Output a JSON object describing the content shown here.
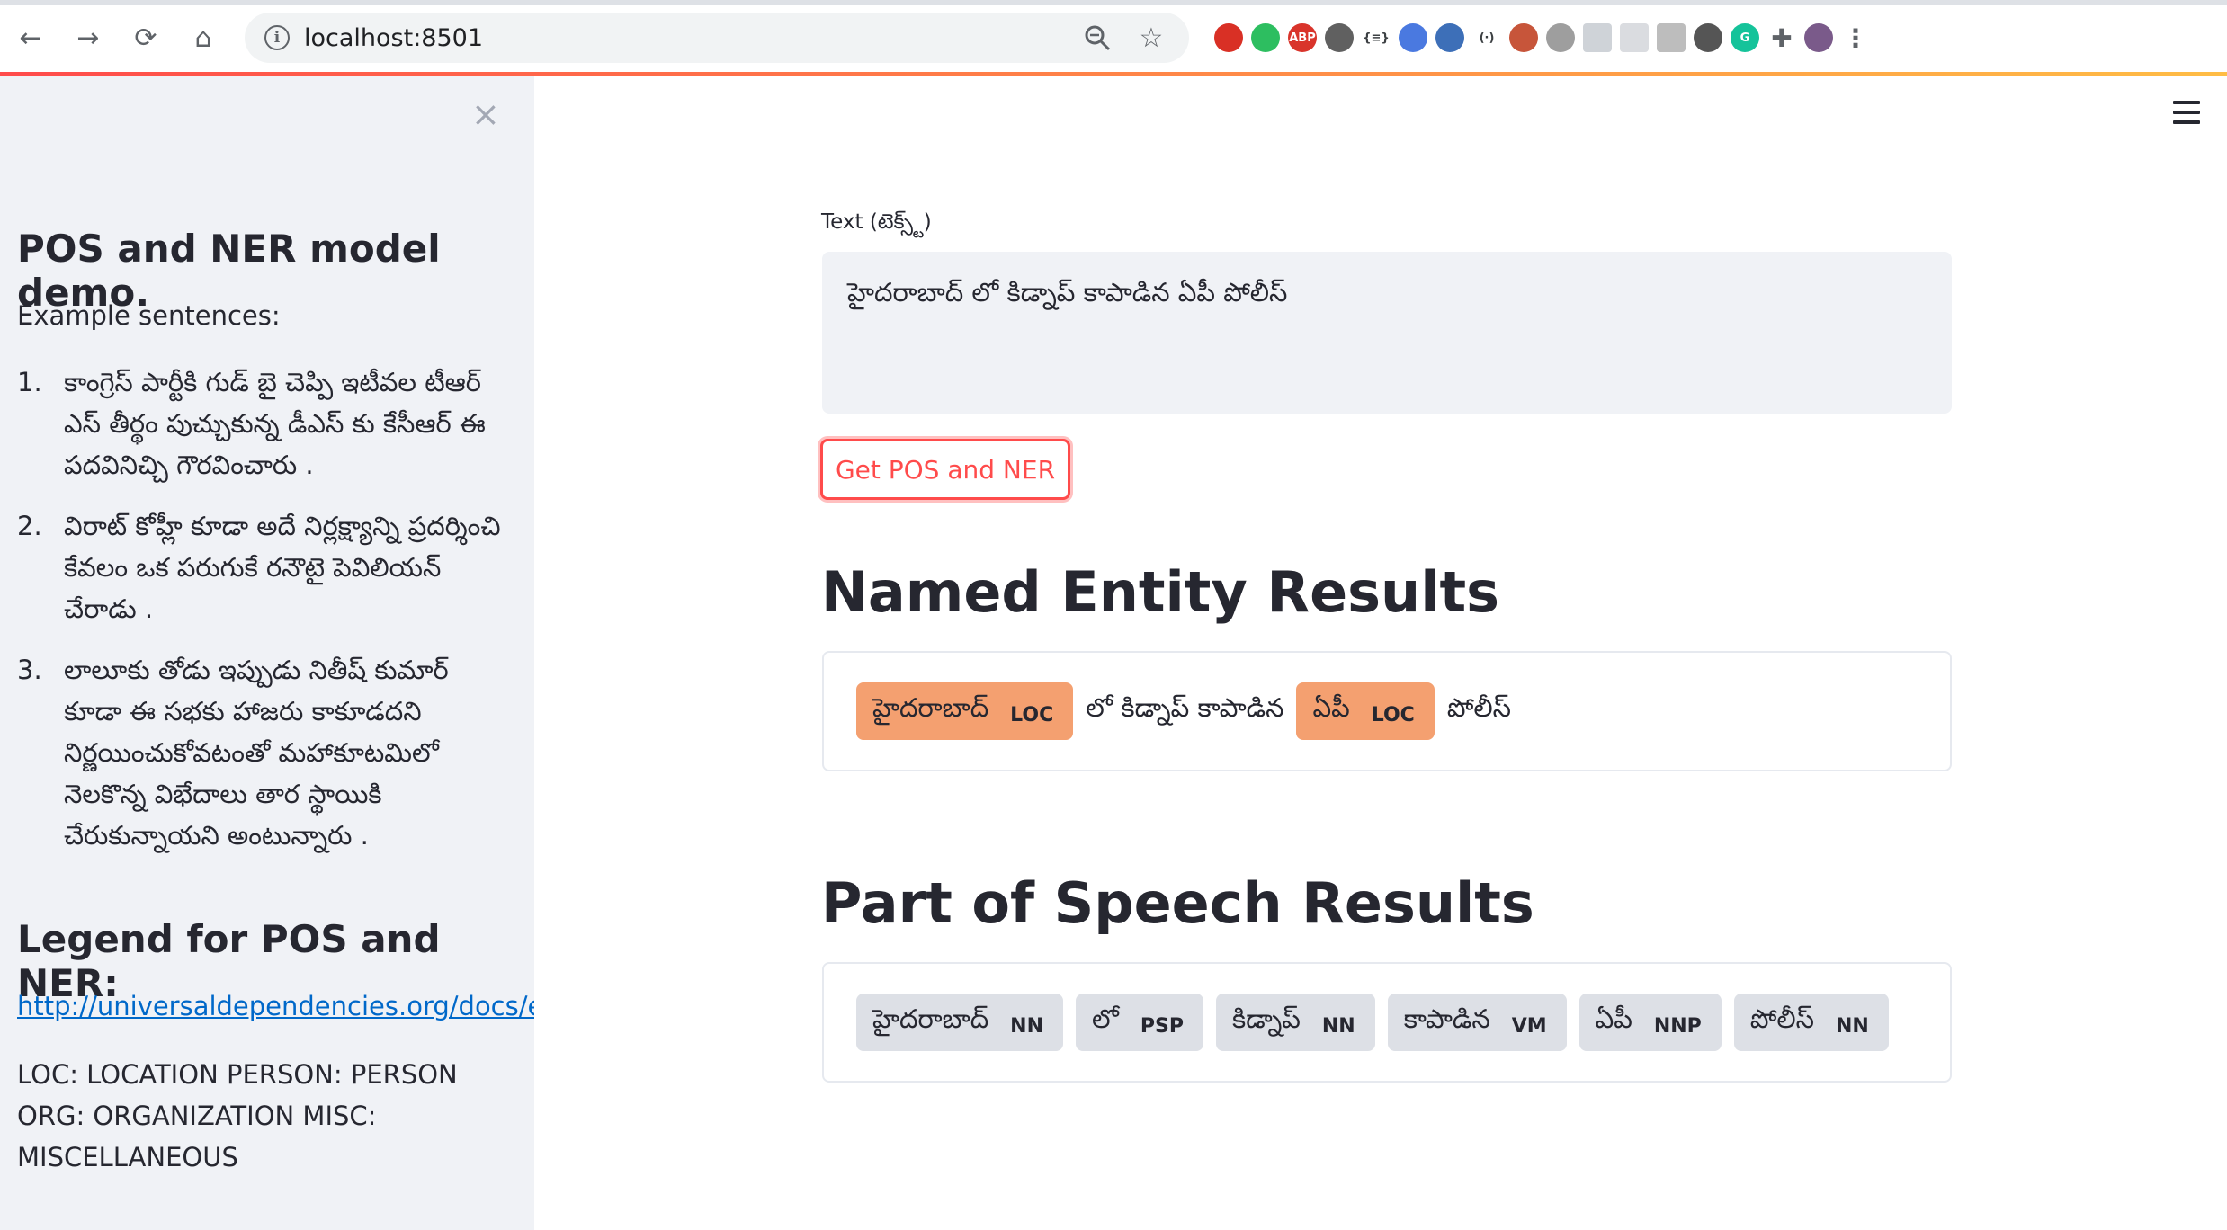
{
  "browser": {
    "url": "localhost:8501",
    "nav": {
      "back": "←",
      "forward": "→",
      "reload": "⟳",
      "home": "⌂"
    },
    "omnibox_icons": {
      "info": "i",
      "zoom": "🔍",
      "bookmark": "☆"
    },
    "extensions": [
      {
        "name": "ublock-icon",
        "glyph": "",
        "color": "#d93025"
      },
      {
        "name": "evernote-icon",
        "glyph": "",
        "color": "#2dbe60"
      },
      {
        "name": "abp-icon",
        "glyph": "ABP",
        "color": "#d9342b"
      },
      {
        "name": "circle-ext-icon",
        "glyph": "",
        "color": "#606060"
      },
      {
        "name": "json-ext-icon",
        "glyph": "{≡}",
        "color": "#ffffff"
      },
      {
        "name": "grad-cap-icon",
        "glyph": "",
        "color": "#4a79e0"
      },
      {
        "name": "onion-ext-icon",
        "glyph": "",
        "color": "#3d6fb8"
      },
      {
        "name": "code-ext-icon",
        "glyph": "(·)",
        "color": "#ffffff"
      },
      {
        "name": "reader-ext-icon",
        "glyph": "",
        "color": "#c7553a"
      },
      {
        "name": "chat-ext-icon",
        "glyph": "",
        "color": "#9e9e9e"
      },
      {
        "name": "screen-ext-icon",
        "glyph": "",
        "color": "#cfd3d8"
      },
      {
        "name": "doc-ext-icon",
        "glyph": "",
        "color": "#dadce0"
      },
      {
        "name": "tag-ext-icon",
        "glyph": "",
        "color": "#bdbdbd"
      },
      {
        "name": "bulb-ext-icon",
        "glyph": "",
        "color": "#555555"
      },
      {
        "name": "grammarly-icon",
        "glyph": "G",
        "color": "#15c39a"
      },
      {
        "name": "puzzle-icon",
        "glyph": "✚",
        "color": "#5f6368"
      },
      {
        "name": "profile-avatar",
        "glyph": "",
        "color": "#7a5a8a"
      },
      {
        "name": "menu-dots-icon",
        "glyph": "⋮",
        "color": "#5f6368"
      }
    ]
  },
  "sidebar": {
    "close": "×",
    "title": "POS and NER model demo.",
    "subtitle": "Example sentences:",
    "examples": [
      {
        "num": "1.",
        "text": "కాంగ్రెస్ పార్టీకి గుడ్ బై చెప్పి ఇటీవల టీఆర్ ఎస్ తీర్థం పుచ్చుకున్న డీఎస్ కు కేసీఆర్ ఈ పదవినిచ్చి గౌరవించారు ."
      },
      {
        "num": "2.",
        "text": "విరాట్ కోహ్లీ కూడా అదే నిర్లక్ష్యాన్ని ప్రదర్శించి కేవలం ఒక పరుగుకే రనౌటై పెవిలియన్ చేరాడు ."
      },
      {
        "num": "3.",
        "text": "లాలూకు తోడు ఇప్పుడు నితీష్ కుమార్ కూడా ఈ సభకు హాజరు కాకూడదని నిర్ణయించుకోవటంతో మహాకూటమిలో నెలకొన్న విభేదాలు తార స్థాయికి చేరుకున్నాయని అంటున్నారు ."
      }
    ],
    "legend_title": "Legend for POS and NER:",
    "legend_link": "http://universaldependencies.org/docs/en/pos",
    "legend_tags": "LOC: LOCATION PERSON: PERSON ORG: ORGANIZATION MISC: MISCELLANEOUS"
  },
  "main": {
    "menu": "≡",
    "text_label": "Text (టెక్స్ట్)",
    "text_value": "హైదరాబాద్ లో కిడ్నాప్ కాపాడిన ఏపీ పోలీస్",
    "button_label": "Get POS and NER",
    "ner_heading": "Named Entity Results",
    "ner_tokens": [
      {
        "word": "హైదరాబాద్",
        "label": "LOC",
        "kind": "entity"
      },
      {
        "word": "లో కిడ్నాప్ కాపాడిన",
        "label": "",
        "kind": "plain"
      },
      {
        "word": "ఏపీ",
        "label": "LOC",
        "kind": "entity"
      },
      {
        "word": "పోలీస్",
        "label": "",
        "kind": "plain"
      }
    ],
    "pos_heading": "Part of Speech Results",
    "pos_tokens": [
      {
        "word": "హైదరాబాద్",
        "label": "NN"
      },
      {
        "word": "లో",
        "label": "PSP"
      },
      {
        "word": "కిడ్నాప్",
        "label": "NN"
      },
      {
        "word": "కాపాడిన",
        "label": "VM"
      },
      {
        "word": "ఏపీ",
        "label": "NNP"
      },
      {
        "word": "పోలీస్",
        "label": "NN"
      }
    ],
    "colors": {
      "entity": "#f4a070",
      "pos": "#dde0e6",
      "primary": "#ff4b4b",
      "link": "#0068c9"
    }
  }
}
